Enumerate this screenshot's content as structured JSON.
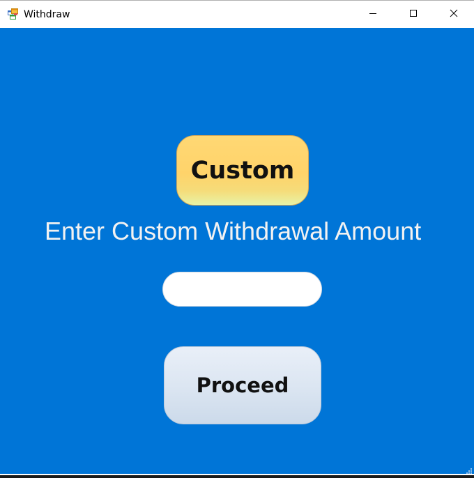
{
  "window": {
    "title": "Withdraw",
    "icon": "windows-form-icon",
    "controls": {
      "minimize_icon": "minimize-icon",
      "maximize_icon": "maximize-icon",
      "close_icon": "close-icon"
    }
  },
  "form": {
    "background_color": "#0075d7",
    "custom_button_label": "Custom",
    "heading": "Enter Custom Withdrawal Amount",
    "amount_value": "",
    "proceed_button_label": "Proceed"
  },
  "colors": {
    "custom_button": "#ffd36a",
    "proceed_button": "#dce6f2",
    "heading_text": "#f2f2f2"
  }
}
